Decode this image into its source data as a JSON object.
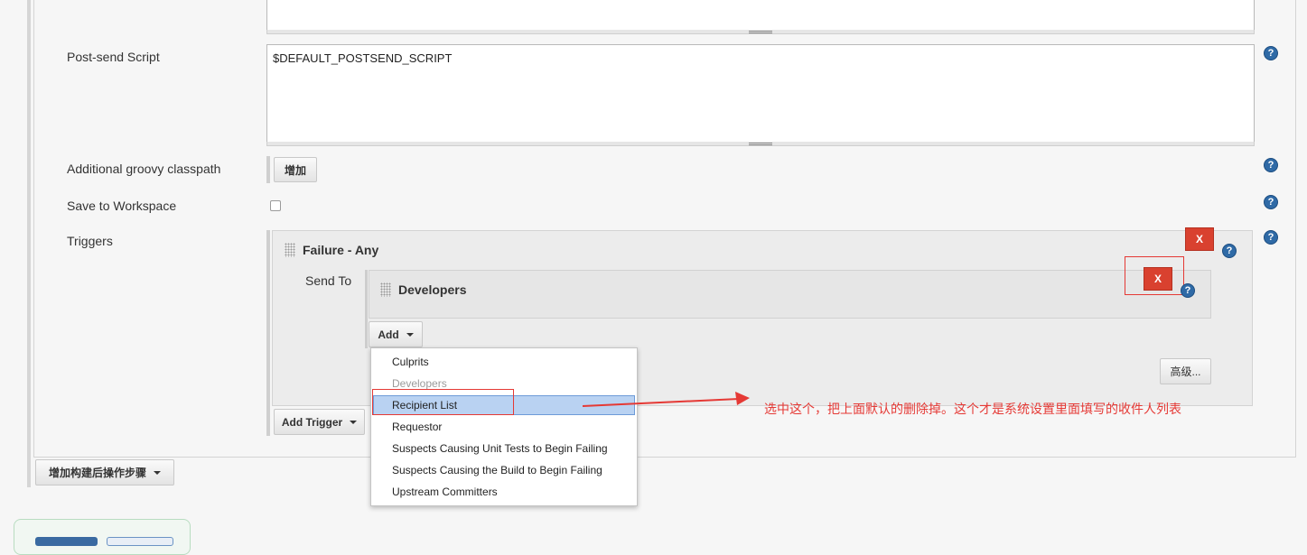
{
  "form": {
    "postsend_label": "Post-send Script",
    "postsend_value": "$DEFAULT_POSTSEND_SCRIPT",
    "groovy_label": "Additional groovy classpath",
    "groovy_add_button": "增加",
    "save_workspace_label": "Save to Workspace",
    "triggers_label": "Triggers",
    "help_glyph": "?"
  },
  "trigger": {
    "title": "Failure - Any",
    "send_to_label": "Send To",
    "delete_label": "X",
    "recipient": {
      "title": "Developers",
      "delete_label": "X"
    },
    "add_button": "Add",
    "advanced_button": "高级...",
    "add_trigger_button": "Add Trigger"
  },
  "add_menu": {
    "items": [
      "Culprits",
      "Developers",
      "Recipient List",
      "Requestor",
      "Suspects Causing Unit Tests to Begin Failing",
      "Suspects Causing the Build to Begin Failing",
      "Upstream Committers"
    ]
  },
  "post_build": {
    "add_step_button": "增加构建后操作步骤"
  },
  "annotation": {
    "text": "选中这个，把上面默认的删除掉。这个才是系统设置里面填写的收件人列表",
    "color": "#e53935"
  }
}
